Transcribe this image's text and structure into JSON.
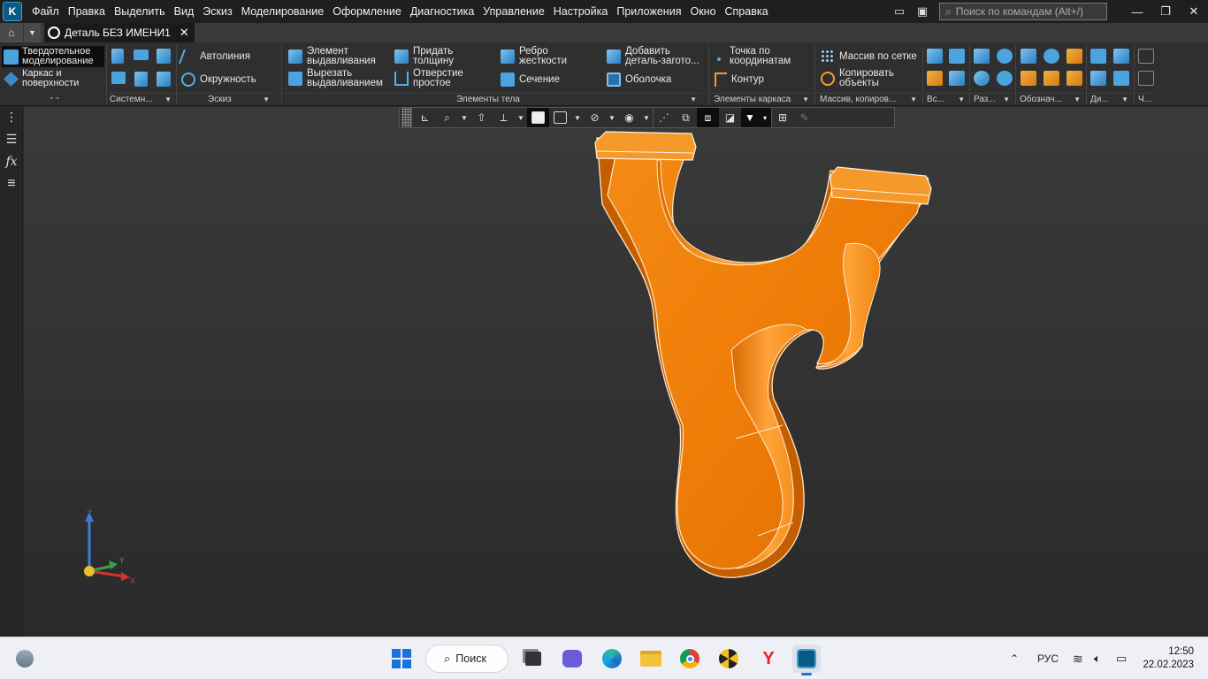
{
  "menubar": {
    "items": [
      "Файл",
      "Правка",
      "Выделить",
      "Вид",
      "Эскиз",
      "Моделирование",
      "Оформление",
      "Диагностика",
      "Управление",
      "Настройка",
      "Приложения",
      "Окно",
      "Справка"
    ],
    "search_placeholder": "Поиск по командам (Alt+/)"
  },
  "tabs": {
    "document_title": "Деталь БЕЗ ИМЕНИ1"
  },
  "ribbon": {
    "modes": [
      "Твердотельное моделирование",
      "Каркас и поверхности"
    ],
    "groups": {
      "system": "Системн...",
      "sketch": "Эскиз",
      "body": "Элементы тела",
      "frame": "Элементы каркаса",
      "array": "Массив, копиров...",
      "aux": "Вс...",
      "sections": "Раз...",
      "notation": "Обознач...",
      "diag": "Ди...",
      "parts": "Ч..."
    },
    "sketch": {
      "autoline": "Автолиния",
      "circle": "Окружность"
    },
    "body": {
      "extrude": "Элемент выдавливания",
      "cut_extrude": "Вырезать выдавливанием",
      "thicken": "Придать толщину",
      "hole": "Отверстие простое",
      "rib": "Ребро жесткости",
      "section": "Сечение",
      "add_blank": "Добавить деталь-загото...",
      "shell": "Оболочка"
    },
    "frame": {
      "point_coords": "Точка по координатам",
      "contour": "Контур"
    },
    "array": {
      "grid_array": "Массив по сетке",
      "copy_objects": "Копировать объекты"
    }
  },
  "triad": {
    "z": "Z",
    "y": "Y",
    "x": "X"
  },
  "taskbar": {
    "search_label": "Поиск",
    "language": "РУС",
    "time": "12:50",
    "date": "22.02.2023"
  },
  "colors": {
    "model_orange": "#f07d0a",
    "viewport_bg": "#333333",
    "ribbon_bg": "#2f2f2f",
    "accent_blue": "#4ba3e0"
  }
}
